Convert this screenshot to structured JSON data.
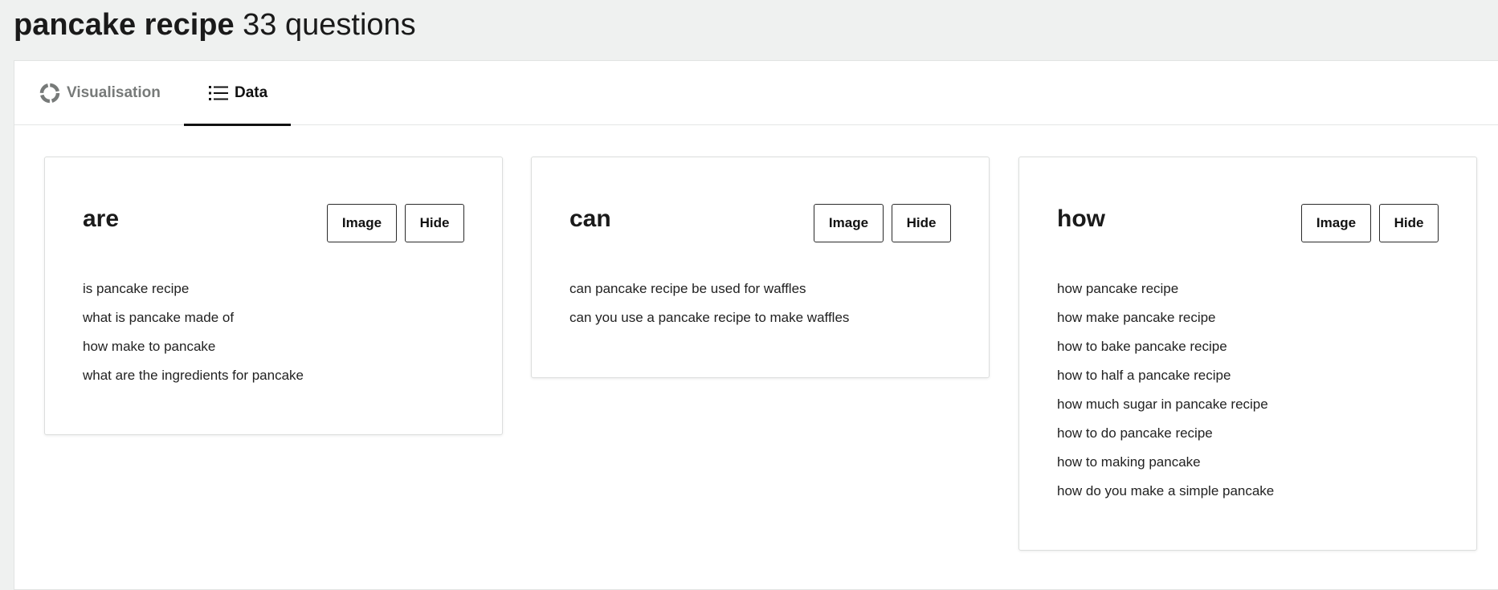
{
  "header": {
    "keyword": "pancake recipe",
    "count_text": "33 questions"
  },
  "tabs": [
    {
      "label": "Visualisation",
      "icon": "donut-chart-icon",
      "active": false
    },
    {
      "label": "Data",
      "icon": "list-icon",
      "active": true
    }
  ],
  "cards": [
    {
      "title": "are",
      "image_label": "Image",
      "hide_label": "Hide",
      "items": [
        "is pancake recipe",
        "what is pancake made of",
        "how make to pancake",
        "what are the ingredients for pancake"
      ]
    },
    {
      "title": "can",
      "image_label": "Image",
      "hide_label": "Hide",
      "items": [
        "can pancake recipe be used for waffles",
        "can you use a pancake recipe to make waffles"
      ]
    },
    {
      "title": "how",
      "image_label": "Image",
      "hide_label": "Hide",
      "items": [
        "how pancake recipe",
        "how make pancake recipe",
        "how to bake pancake recipe",
        "how to half a pancake recipe",
        "how much sugar in pancake recipe",
        "how to do pancake recipe",
        "how to making pancake",
        "how do you make a simple pancake"
      ]
    }
  ]
}
